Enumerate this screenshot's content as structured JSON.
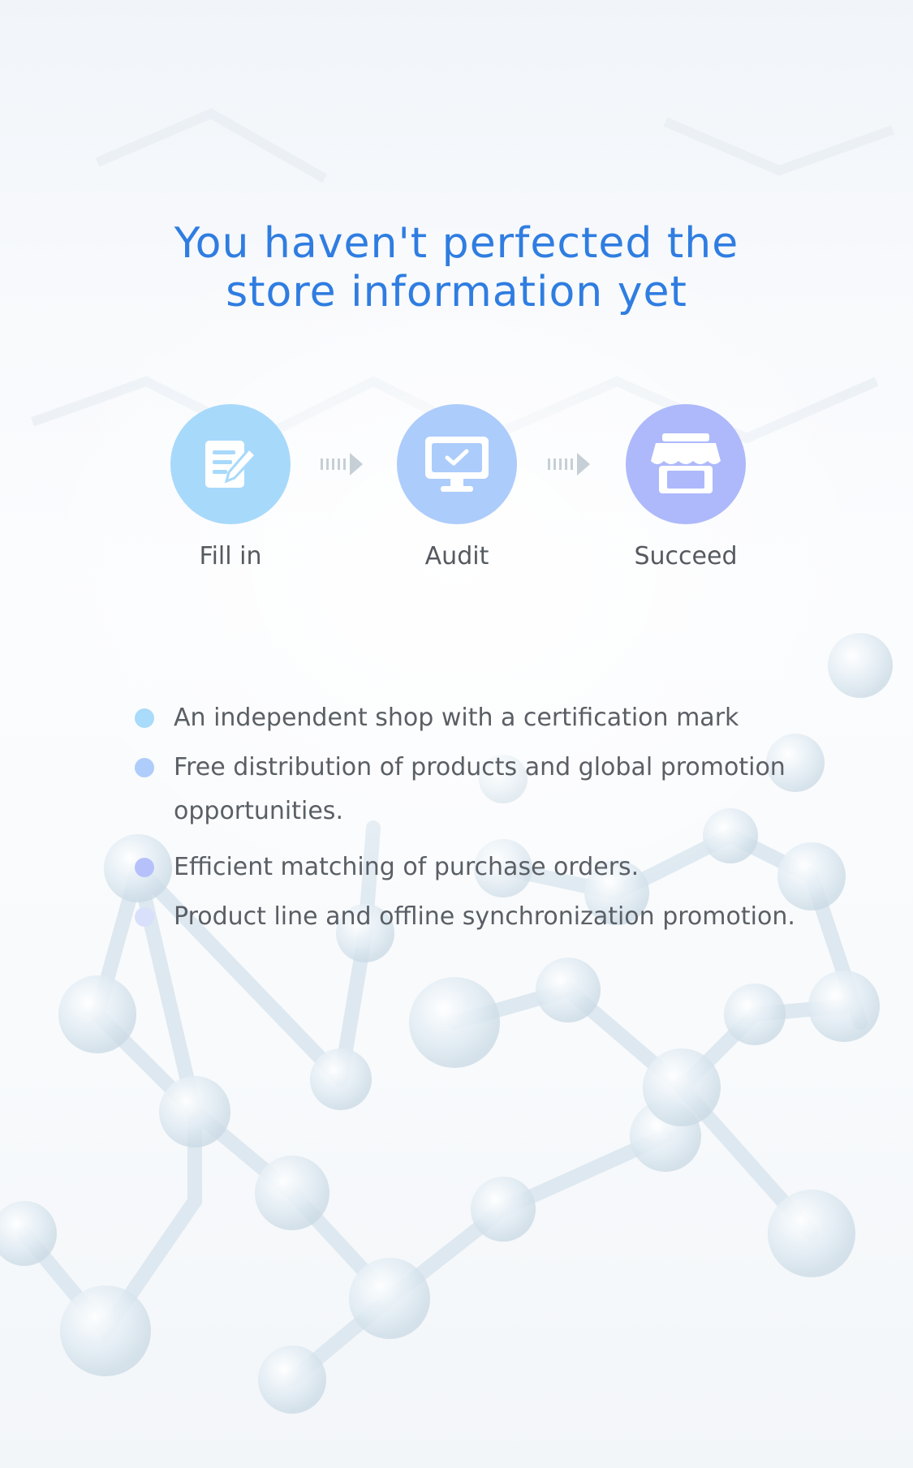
{
  "header": {
    "title_line1": "You haven't perfected the",
    "title_line2": "store information yet",
    "title_color": "#2f7de1"
  },
  "steps": [
    {
      "label": "Fill in",
      "icon": "form-edit-icon",
      "color": "#a7d9fb"
    },
    {
      "label": "Audit",
      "icon": "monitor-check-icon",
      "color": "#acccfb"
    },
    {
      "label": "Succeed",
      "icon": "storefront-icon",
      "color": "#aeb9fb"
    }
  ],
  "step_arrow_icon": "double-chevron-arrow-icon",
  "benefits": [
    {
      "text": "An independent shop with a certification mark",
      "dot_color": "#a9dbfa"
    },
    {
      "text": "Free distribution of products and global promotion opportunities.",
      "dot_color": "#aecdfa"
    },
    {
      "text": "Efficient matching of purchase orders.",
      "dot_color": "#b6c1fb"
    },
    {
      "text": "Product line and offline synchronization promotion.",
      "dot_color": "#d9e0fb"
    }
  ]
}
